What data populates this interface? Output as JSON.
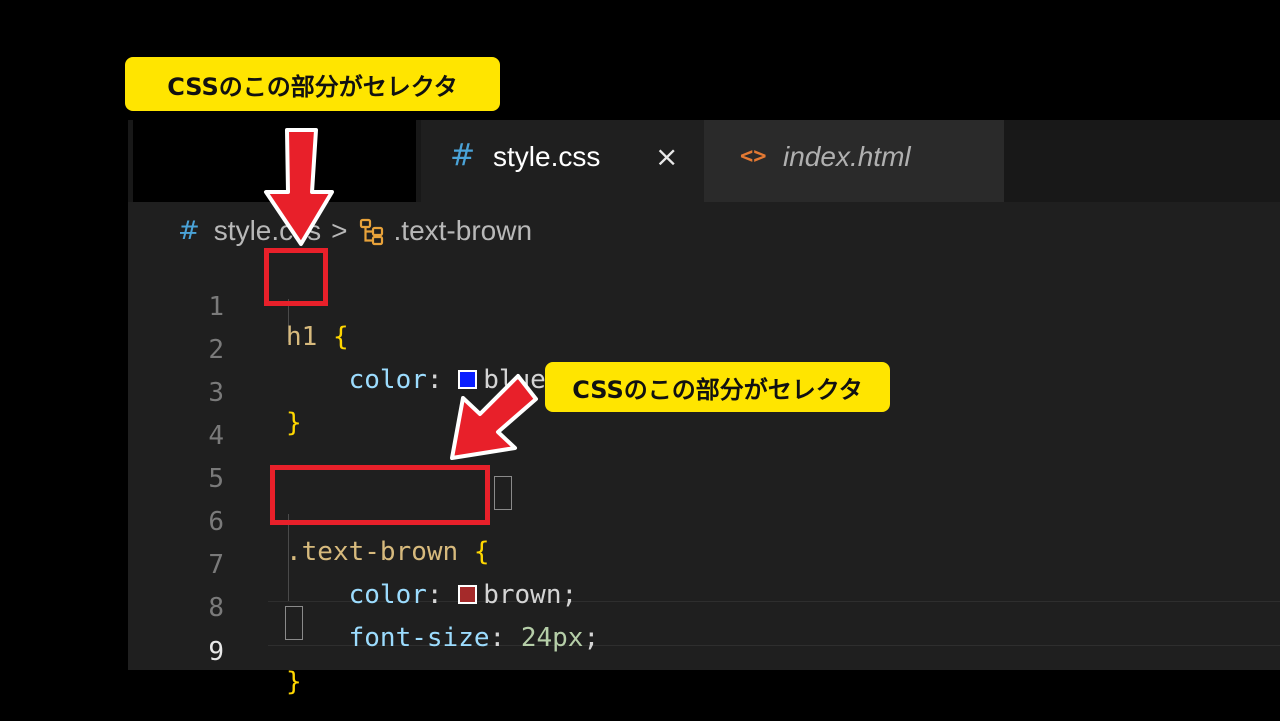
{
  "tabs": {
    "active": {
      "icon": "#",
      "label": "style.css",
      "close": "×"
    },
    "inactive": {
      "icon": "<>",
      "label": "index.html"
    }
  },
  "breadcrumb": {
    "hash": "#",
    "file": "style.css",
    "separator": ">",
    "symbol_icon": "symbol-class-icon",
    "symbol": ".text-brown"
  },
  "code_lines": {
    "l1": {
      "num": "1",
      "selector": "h1",
      "brace": "{"
    },
    "l2": {
      "num": "2",
      "prop": "color",
      "colon": ": ",
      "value": "blue;",
      "swatch": "#0a1fff"
    },
    "l3": {
      "num": "3",
      "brace": "}"
    },
    "l4": {
      "num": "4"
    },
    "l5": {
      "num": "5"
    },
    "l6": {
      "num": "6",
      "selector": ".text-brown",
      "brace": "{"
    },
    "l7": {
      "num": "7",
      "prop": "color",
      "colon": ": ",
      "value": "brown;",
      "swatch": "#a52a2a"
    },
    "l8": {
      "num": "8",
      "prop": "font-size",
      "colon": ": ",
      "value": "24px",
      "semi": ";"
    },
    "l9": {
      "num": "9",
      "brace": "}"
    }
  },
  "annotations": {
    "callout_top": "CSSのこの部分がセレクタ",
    "callout_mid": "CSSのこの部分がセレクタ",
    "highlight_color": "#e8202a",
    "callout_color": "#ffe500"
  }
}
